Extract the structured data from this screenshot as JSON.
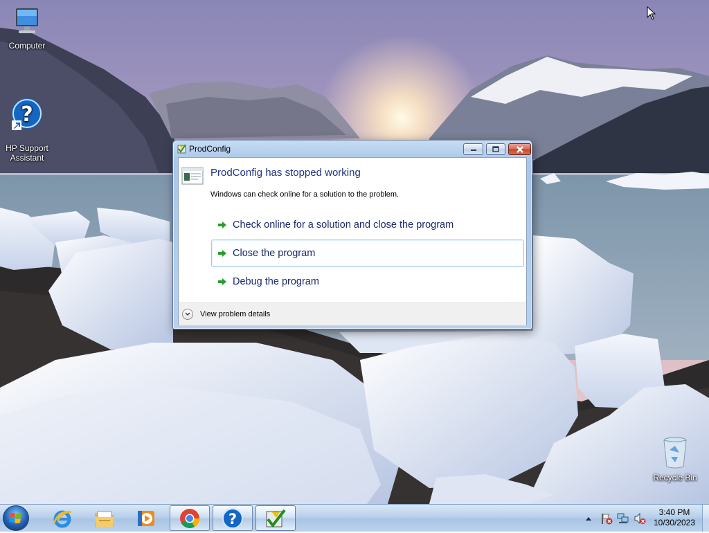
{
  "desktop": {
    "icons": [
      {
        "label": "Computer",
        "icon": "computer-icon"
      },
      {
        "label": "HP Support\nAssistant",
        "icon": "hp-support-icon"
      },
      {
        "label": "Recycle Bin",
        "icon": "recycle-bin-icon"
      }
    ]
  },
  "dialog": {
    "title": "ProdConfig",
    "main_instruction": "ProdConfig has stopped working",
    "content": "Windows can check online for a solution to the problem.",
    "commands": [
      {
        "label": "Check online for a solution and close the program",
        "focused": false
      },
      {
        "label": "Close the program",
        "focused": true
      },
      {
        "label": "Debug the program",
        "focused": false
      }
    ],
    "details_toggle": "View problem details",
    "caption_buttons": [
      "minimize",
      "maximize",
      "close"
    ],
    "colors": {
      "instruction": "#1e3287",
      "arrow": "#2a9d2a",
      "link": "#1a2a6a"
    }
  },
  "taskbar": {
    "pinned": [
      {
        "name": "Internet Explorer",
        "icon": "ie-icon",
        "open": false
      },
      {
        "name": "Windows Explorer",
        "icon": "folder-icon",
        "open": false
      },
      {
        "name": "Windows Media Player",
        "icon": "media-player-icon",
        "open": false
      },
      {
        "name": "Google Chrome",
        "icon": "chrome-icon",
        "open": true
      },
      {
        "name": "HP Support Assistant",
        "icon": "help-icon",
        "open": true
      },
      {
        "name": "ProdConfig",
        "icon": "prodconfig-icon",
        "open": true,
        "active": true
      }
    ],
    "tray_icons": [
      "show-hidden-icons-arrow",
      "action-center-flag-icon",
      "network-icon",
      "volume-muted-icon"
    ],
    "clock": {
      "time": "3:40 PM",
      "date": "10/30/2023"
    }
  }
}
